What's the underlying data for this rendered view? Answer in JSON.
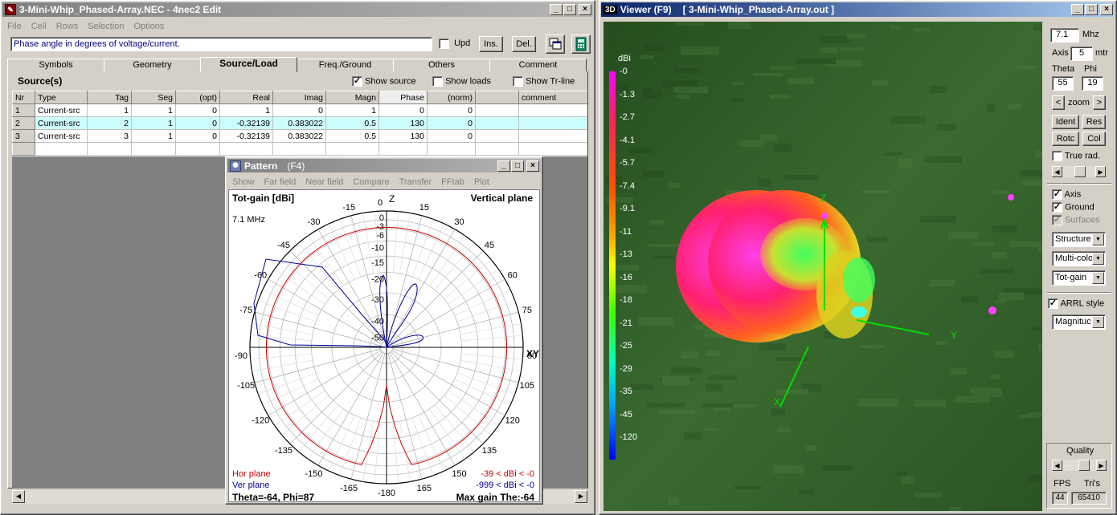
{
  "editor": {
    "title": "3-Mini-Whip_Phased-Array.NEC - 4nec2 Edit",
    "menu": [
      "File",
      "Cell",
      "Rows",
      "Selection",
      "Options"
    ],
    "hint": "Phase angle in degrees of voltage/current.",
    "upd_label": "Upd",
    "ins_label": "Ins.",
    "del_label": "Del.",
    "tabs": [
      "Symbols",
      "Geometry",
      "Source/Load",
      "Freq./Ground",
      "Others",
      "Comment"
    ],
    "section_title": "Source(s)",
    "show_source": "Show source",
    "show_loads": "Show loads",
    "show_trline": "Show Tr-line",
    "columns": [
      "Nr",
      "Type",
      "Tag",
      "Seg",
      "(opt)",
      "Real",
      "Imag",
      "Magn",
      "Phase",
      "(norm)",
      "",
      "comment"
    ],
    "rows": [
      [
        "1",
        "Current-src",
        "1",
        "1",
        "0",
        "1",
        "0",
        "1",
        "0",
        "0",
        "",
        ""
      ],
      [
        "2",
        "Current-src",
        "2",
        "1",
        "0",
        "-0.32139",
        "0.383022",
        "0.5",
        "130",
        "0",
        "",
        ""
      ],
      [
        "3",
        "Current-src",
        "3",
        "1",
        "0",
        "-0.32139",
        "0.383022",
        "0.5",
        "130",
        "0",
        "",
        ""
      ]
    ]
  },
  "pattern": {
    "title": "Pattern",
    "hotkey": "(F4)",
    "menu": [
      "Show",
      "Far field",
      "Near field",
      "Compare",
      "Transfer",
      "FFtab",
      "Plot"
    ],
    "gain_label": "Tot-gain [dBi]",
    "plane_label": "Vertical plane",
    "freq": "7.1 MHz",
    "z_label": "Z",
    "xy_label": "XY",
    "angle_labels": [
      "0",
      "15",
      "30",
      "45",
      "60",
      "75",
      "90",
      "105",
      "120",
      "135",
      "150",
      "165",
      "-180",
      "-165",
      "-150",
      "-135",
      "-120",
      "-105",
      "-90",
      "-75",
      "-60",
      "-45",
      "-30",
      "-15"
    ],
    "db_labels": [
      "0",
      "-3",
      "-6",
      "-10",
      "-15",
      "-20",
      "-30",
      "-40",
      "-50"
    ],
    "hor_label": "Hor plane",
    "ver_label": "Ver plane",
    "hor_range": "-39 < dBi < -0",
    "ver_range": "-999 < dBi < -0",
    "theta_phi": "Theta=-64, Phi=87",
    "max_gain": "Max gain The:-64",
    "colors": {
      "hor": "#cc0000",
      "ver": "#000099"
    }
  },
  "viewer": {
    "title": "Viewer (F9)",
    "file": "[ 3-Mini-Whip_Phased-Array.out ]",
    "scale_unit": "dBi",
    "scale": [
      "-0",
      "-1.3",
      "-2.7",
      "-4.1",
      "-5.7",
      "-7.4",
      "-9.1",
      "-11",
      "-13",
      "-16",
      "-18",
      "-21",
      "-25",
      "-29",
      "-35",
      "-45",
      "-120"
    ],
    "freq": "7.1",
    "freq_unit": "Mhz",
    "axis_label": "Axis",
    "axis_value": "5",
    "axis_unit": "mtr",
    "theta_label": "Theta",
    "phi_label": "Phi",
    "theta": "55",
    "phi": "19",
    "zoom_label": "zoom",
    "ident": "Ident",
    "res": "Res",
    "rotc": "Rotc",
    "col": "Col",
    "true_rad": "True rad.",
    "axis_chk": "Axis",
    "ground_chk": "Ground",
    "surfaces_chk": "Surfaces",
    "combo_structure": "Structure",
    "combo_color": "Multi-colo",
    "combo_gain": "Tot-gain",
    "arrl": "ARRL style",
    "combo_mag": "Magnituc",
    "quality": "Quality",
    "fps_label": "FPS",
    "tris_label": "Tri's",
    "fps": "44",
    "tris": "65410",
    "axis_x": "X",
    "axis_y": "Y",
    "axis_z": "Z"
  }
}
